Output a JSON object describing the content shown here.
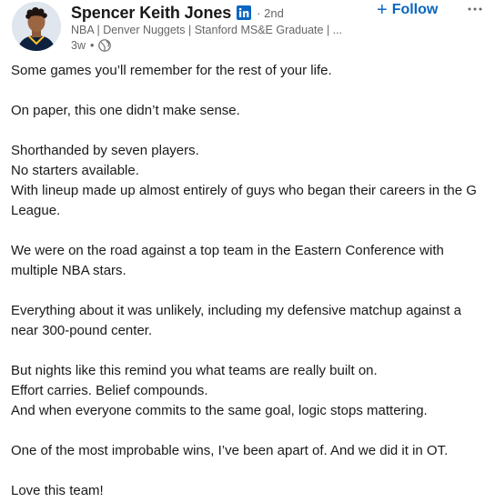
{
  "author": {
    "name": "Spencer Keith Jones",
    "degree": "2nd",
    "headline": "NBA | Denver Nuggets | Stanford MS&E Graduate | ...",
    "time_ago": "3w",
    "visibility_icon": "globe-icon",
    "badge_icon": "linkedin-icon"
  },
  "actions": {
    "follow_label": "Follow",
    "follow_icon": "+",
    "more_icon": "···"
  },
  "colors": {
    "accent": "#0a66c2",
    "text": "#191919",
    "muted": "#666666"
  },
  "post": {
    "paragraphs": [
      [
        "Some games you’ll remember for the rest of your life."
      ],
      [
        "On paper, this one didn’t make sense."
      ],
      [
        "Shorthanded by seven players.",
        "No starters available.",
        "With lineup made up almost entirely of guys who began their careers in the G League."
      ],
      [
        "We were on the road against a top team in the Eastern Conference with multiple NBA stars."
      ],
      [
        "Everything about it was unlikely, including my defensive matchup against a near 300-pound center."
      ],
      [
        "But nights like this remind you what teams are really built on.",
        "Effort carries. Belief compounds.",
        "And when everyone commits to the same goal, logic stops mattering."
      ],
      [
        "One of the most improbable wins, I’ve been apart of. And we did it in OT."
      ],
      [
        "Love this team!"
      ]
    ]
  }
}
